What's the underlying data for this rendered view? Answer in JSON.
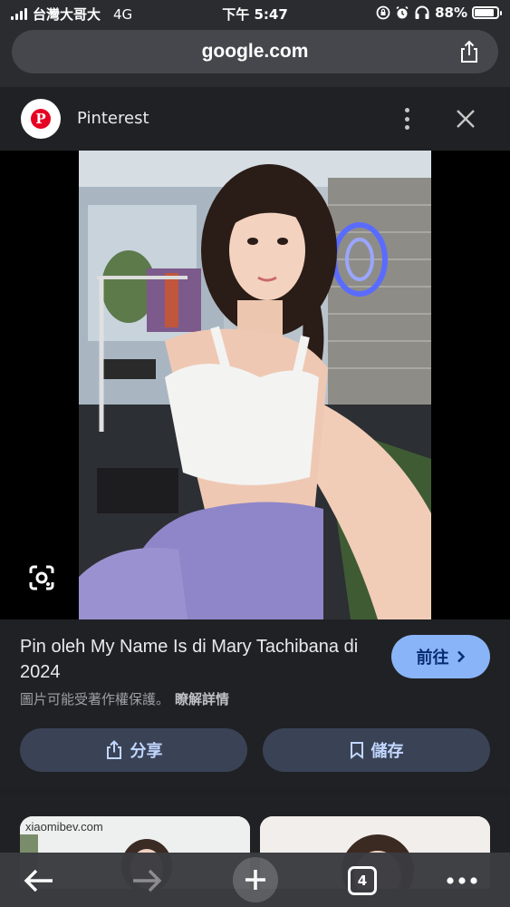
{
  "status_bar": {
    "carrier": "台灣大哥大",
    "network": "4G",
    "time": "下午 5:47",
    "battery": "88%",
    "battery_level": 0.88,
    "icons": [
      "rotation-lock-icon",
      "alarm-icon",
      "headphones-icon",
      "battery-icon"
    ]
  },
  "browser": {
    "url": "google.com"
  },
  "result": {
    "source_name": "Pinterest",
    "source_logo": "P",
    "title": "Pin oleh My Name Is di Mary Tachibana di 2024",
    "goto_label": "前往",
    "copyright_notice": "圖片可能受著作權保護。",
    "learn_more": "瞭解詳情",
    "share_label": "分享",
    "save_label": "儲存"
  },
  "more_results": [
    {
      "watermark": "xiaomibev.com"
    },
    {
      "watermark": ""
    }
  ],
  "toolbar": {
    "tab_count": "4"
  },
  "colors": {
    "accent": "#8ab4f8",
    "action_bg": "#3a4356",
    "pinterest_red": "#e60023"
  }
}
